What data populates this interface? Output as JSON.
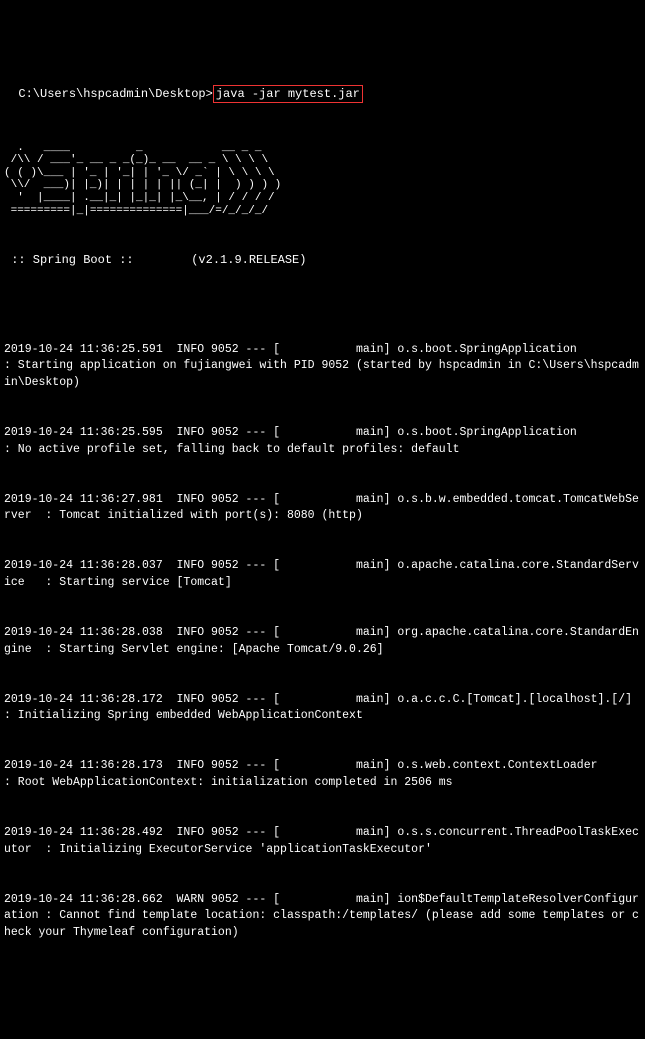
{
  "prompt": {
    "path": "C:\\Users\\hspcadmin\\Desktop>",
    "command": "java -jar mytest.jar"
  },
  "ascii_art": "  .   ____          _            __ _ _\n /\\\\ / ___'_ __ _ _(_)_ __  __ _ \\ \\ \\ \\\n( ( )\\___ | '_ | '_| | '_ \\/ _` | \\ \\ \\ \\\n \\\\/  ___)| |_)| | | | | || (_| |  ) ) ) )\n  '  |____| .__|_| |_|_| |_\\__, | / / / /\n =========|_|==============|___/=/_/_/_/",
  "banner": " :: Spring Boot ::        (v2.1.9.RELEASE)",
  "log_lines": [
    "2019-10-24 11:36:25.591  INFO 9052 --- [           main] o.s.boot.SpringApplication               : Starting application on fujiangwei with PID 9052 (started by hspcadmin in C:\\Users\\hspcadmin\\Desktop)",
    "2019-10-24 11:36:25.595  INFO 9052 --- [           main] o.s.boot.SpringApplication               : No active profile set, falling back to default profiles: default",
    "2019-10-24 11:36:27.981  INFO 9052 --- [           main] o.s.b.w.embedded.tomcat.TomcatWebServer  : Tomcat initialized with port(s): 8080 (http)",
    "2019-10-24 11:36:28.037  INFO 9052 --- [           main] o.apache.catalina.core.StandardService   : Starting service [Tomcat]",
    "2019-10-24 11:36:28.038  INFO 9052 --- [           main] org.apache.catalina.core.StandardEngine  : Starting Servlet engine: [Apache Tomcat/9.0.26]",
    "2019-10-24 11:36:28.172  INFO 9052 --- [           main] o.a.c.c.C.[Tomcat].[localhost].[/]       : Initializing Spring embedded WebApplicationContext",
    "2019-10-24 11:36:28.173  INFO 9052 --- [           main] o.s.web.context.ContextLoader            : Root WebApplicationContext: initialization completed in 2506 ms",
    "2019-10-24 11:36:28.492  INFO 9052 --- [           main] o.s.s.concurrent.ThreadPoolTaskExecutor  : Initializing ExecutorService 'applicationTaskExecutor'",
    "2019-10-24 11:36:28.662  WARN 9052 --- [           main] ion$DefaultTemplateResolverConfiguration : Cannot find template location: classpath:/templates/ (please add some templates or check your Thymeleaf configuration)"
  ]
}
